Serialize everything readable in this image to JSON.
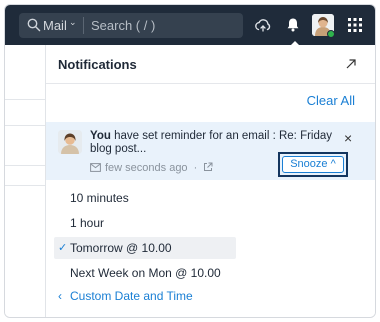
{
  "topbar": {
    "search_scope": "Mail",
    "search_placeholder": "Search ( / )",
    "icons": [
      "search-icon",
      "cloud-sync-icon",
      "bell-icon",
      "avatar",
      "apps-grid-icon"
    ]
  },
  "panel": {
    "title": "Notifications",
    "clear_all": "Clear All"
  },
  "notification": {
    "actor": "You",
    "message": " have set reminder for an email : Re: Friday blog post...",
    "time": "few seconds ago",
    "close": "×",
    "snooze_label": "Snooze",
    "snooze_caret": "^"
  },
  "snooze_menu": {
    "items": [
      {
        "label": "10 minutes",
        "selected": false
      },
      {
        "label": "1 hour",
        "selected": false
      },
      {
        "label": "Tomorrow @ 10.00",
        "selected": true
      },
      {
        "label": "Next Week on Mon @ 10.00",
        "selected": false
      }
    ],
    "custom_label": "Custom Date and Time"
  },
  "colors": {
    "topbar": "#1f2b3a",
    "accent": "#1a7fd4",
    "notification_bg": "#e9f2fb",
    "highlight_outline": "#13355e"
  }
}
